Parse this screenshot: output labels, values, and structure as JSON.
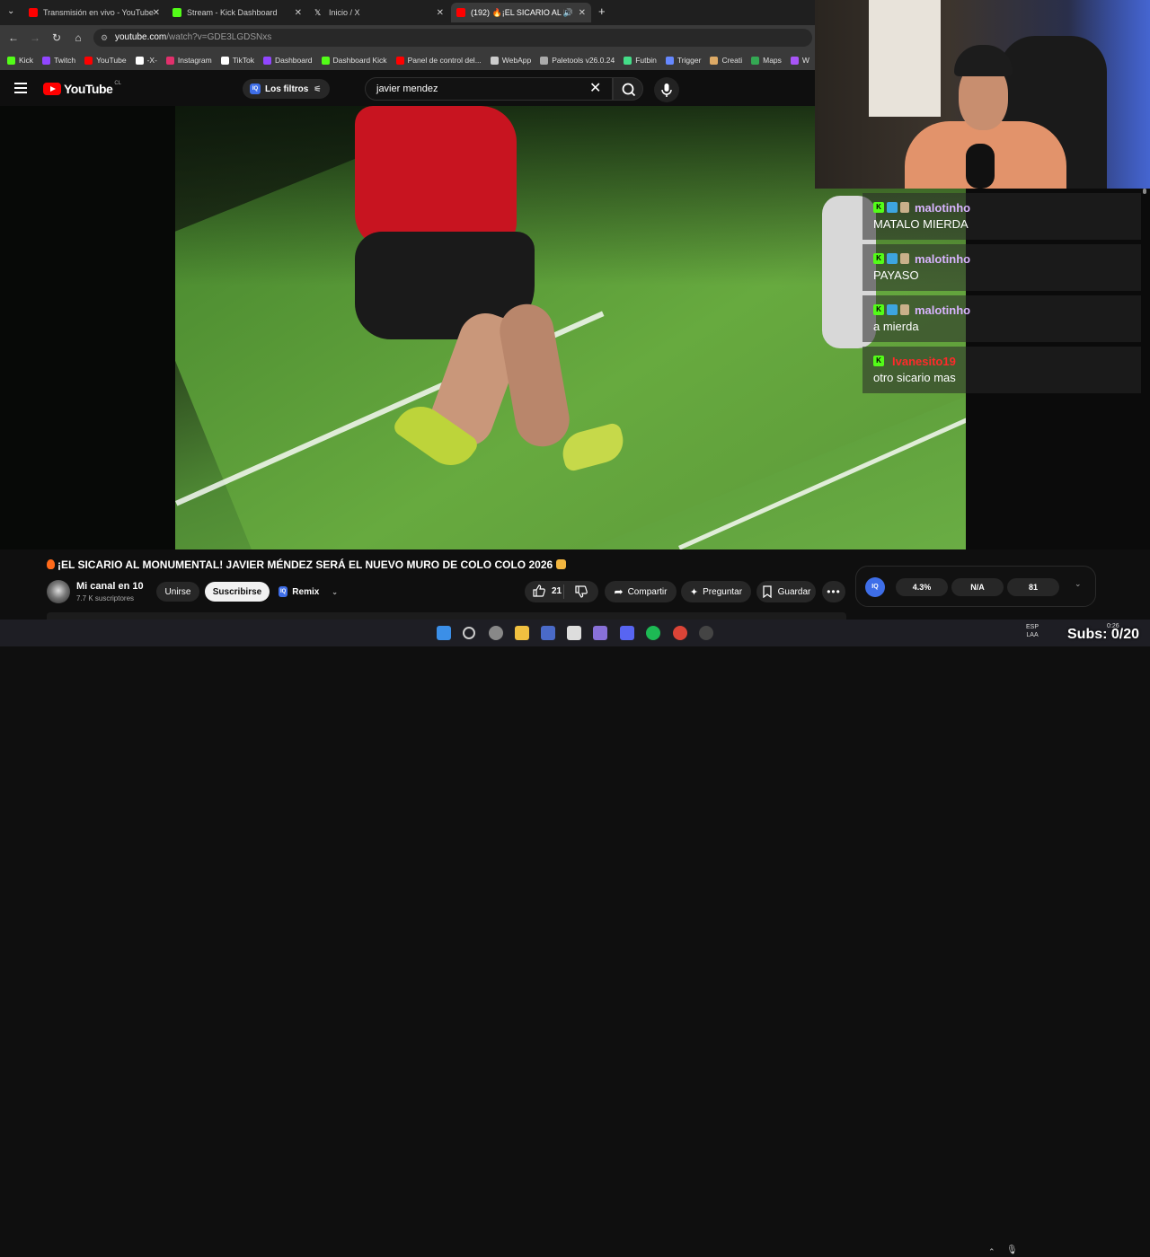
{
  "browser": {
    "tabs": [
      {
        "title": "Transmisión en vivo - YouTube",
        "favicon_color": "#ff0000",
        "active": false
      },
      {
        "title": "Stream - Kick Dashboard",
        "favicon_color": "#53fc18",
        "active": false
      },
      {
        "title": "Inicio / X",
        "favicon_color": "#ffffff",
        "active": false
      },
      {
        "title": "(192) 🔥¡EL SICARIO AL M…",
        "favicon_color": "#ff0000",
        "active": true
      }
    ],
    "new_tab": "+",
    "url_host": "youtube.com",
    "url_path": "/watch?v=GDE3LGDSNxs",
    "bookmarks": [
      {
        "label": "Kick",
        "color": "#53fc18"
      },
      {
        "label": "Twitch",
        "color": "#9146ff"
      },
      {
        "label": "YouTube",
        "color": "#ff0000"
      },
      {
        "label": "-X-",
        "color": "#ffffff"
      },
      {
        "label": "Instagram",
        "color": "#e1306c"
      },
      {
        "label": "TikTok",
        "color": "#ffffff"
      },
      {
        "label": "Dashboard",
        "color": "#9146ff"
      },
      {
        "label": "Dashboard Kick",
        "color": "#53fc18"
      },
      {
        "label": "Panel de control del...",
        "color": "#ff0000"
      },
      {
        "label": "WebApp",
        "color": "#cccccc"
      },
      {
        "label": "Paletools v26.0.24",
        "color": "#aaaaaa"
      },
      {
        "label": "Futbin",
        "color": "#44dd88"
      },
      {
        "label": "Trigger",
        "color": "#6688ff"
      },
      {
        "label": "Creati",
        "color": "#ddaa66"
      },
      {
        "label": "Maps",
        "color": "#34a853"
      },
      {
        "label": "W",
        "color": "#a855f7"
      }
    ]
  },
  "youtube": {
    "logo_text": "YouTube",
    "country": "CL",
    "filters_label": "Los filtros",
    "search_value": "javier mendez",
    "video_title": "¡EL SICARIO AL MONUMENTAL! JAVIER MÉNDEZ SERÁ EL NUEVO MURO DE COLO COLO 2026",
    "channel_name": "Mi canal en 10",
    "subscribers": "7.7 K suscriptores",
    "join_label": "Unirse",
    "subscribe_label": "Suscribirse",
    "remix_label": "Remix",
    "like_count": "21",
    "share_label": "Compartir",
    "ask_label": "Preguntar",
    "save_label": "Guardar",
    "more_label": "•••"
  },
  "stats_widget": {
    "badge": "IQ",
    "values": [
      "4.3%",
      "N/A",
      "81"
    ]
  },
  "chat": {
    "messages": [
      {
        "user": "malotinho",
        "text": "MATALO MIERDA",
        "badges": [
          "kick",
          "sub",
          "gift"
        ],
        "user_color": "#d8b4fe"
      },
      {
        "user": "malotinho",
        "text": "PAYASO",
        "badges": [
          "kick",
          "sub",
          "gift"
        ],
        "user_color": "#d8b4fe"
      },
      {
        "user": "malotinho",
        "text": "a mierda",
        "badges": [
          "kick",
          "sub",
          "gift"
        ],
        "user_color": "#d8b4fe"
      },
      {
        "user": "Ivanesito19",
        "text": "otro sicario mas",
        "badges": [
          "kick"
        ],
        "user_color": "#ff2a2a"
      }
    ]
  },
  "taskbar": {
    "lang_top": "ESP",
    "lang_bottom": "LAA",
    "time": "0:26"
  },
  "overlay": {
    "subs_goal": "Subs: 0/20"
  }
}
